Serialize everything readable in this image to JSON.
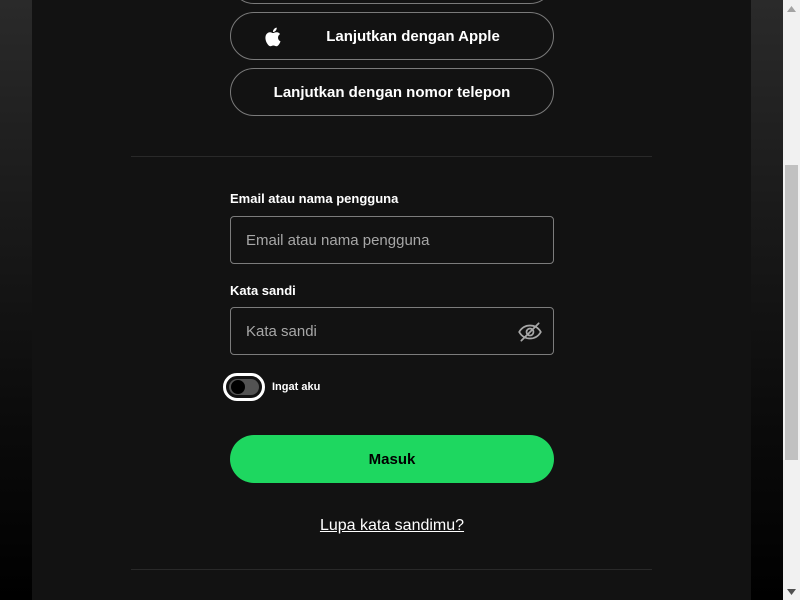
{
  "oauth": {
    "apple_label": "Lanjutkan dengan Apple",
    "phone_label": "Lanjutkan dengan nomor telepon"
  },
  "login_form": {
    "email": {
      "label": "Email atau nama pengguna",
      "placeholder": "Email atau nama pengguna",
      "value": ""
    },
    "password": {
      "label": "Kata sandi",
      "placeholder": "Kata sandi",
      "value": ""
    },
    "remember": {
      "label": "Ingat aku",
      "checked": false
    },
    "submit_label": "Masuk",
    "forgot_label": "Lupa kata sandimu?"
  },
  "icons": {
    "apple": "apple-icon",
    "password_visibility": "eye-off-icon",
    "scroll_up": "arrow-up-icon",
    "scroll_down": "arrow-down-icon"
  },
  "colors": {
    "accent": "#1ed760",
    "card_background": "#121212",
    "border": "#7c7c7c"
  }
}
